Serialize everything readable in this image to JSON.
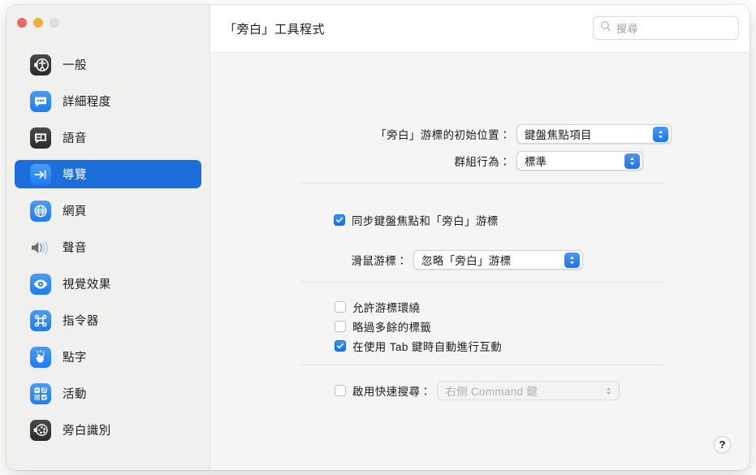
{
  "window": {
    "title": "「旁白」工具程式",
    "traffic_lights": [
      {
        "name": "close",
        "color": "#e8695f"
      },
      {
        "name": "minimize",
        "color": "#edb13e"
      },
      {
        "name": "zoom",
        "color": "#dddddd"
      }
    ]
  },
  "search": {
    "placeholder": "搜尋",
    "value": "",
    "icon": "search-icon"
  },
  "sidebar": {
    "items": [
      {
        "label": "一般",
        "icon": "voiceover-general-icon",
        "selected": false
      },
      {
        "label": "詳細程度",
        "icon": "speech-bubble-dots-icon",
        "selected": false
      },
      {
        "label": "語音",
        "icon": "speech-panel-icon",
        "selected": false
      },
      {
        "label": "導覽",
        "icon": "arrow-to-line-icon",
        "selected": true
      },
      {
        "label": "網頁",
        "icon": "globe-icon",
        "selected": false
      },
      {
        "label": "聲音",
        "icon": "speaker-waves-icon",
        "selected": false
      },
      {
        "label": "視覺效果",
        "icon": "eye-icon",
        "selected": false
      },
      {
        "label": "指令器",
        "icon": "command-key-icon",
        "selected": false
      },
      {
        "label": "點字",
        "icon": "braille-hand-icon",
        "selected": false
      },
      {
        "label": "活動",
        "icon": "activities-grid-icon",
        "selected": false
      },
      {
        "label": "旁白識別",
        "icon": "voiceover-recognition-icon",
        "selected": false
      }
    ]
  },
  "main": {
    "cursor_start_label": "「旁白」游標的初始位置：",
    "cursor_start_value": "鍵盤焦點項目",
    "group_behavior_label": "群組行為：",
    "group_behavior_value": "標準",
    "sync_checkbox_label": "同步鍵盤焦點和「旁白」游標",
    "sync_checkbox_checked": true,
    "mouse_cursor_label": "滑鼠游標：",
    "mouse_cursor_value": "忽略「旁白」游標",
    "allow_wrap_label": "允許游標環繞",
    "allow_wrap_checked": false,
    "skip_redundant_label": "略過多餘的標籤",
    "skip_redundant_checked": false,
    "tab_interact_label": "在使用 Tab 鍵時自動進行互動",
    "tab_interact_checked": true,
    "quicknav_label": "啟用快速搜尋：",
    "quicknav_checked": false,
    "quicknav_value": "右側 Command 鍵",
    "quicknav_disabled": true,
    "help_label": "?"
  },
  "colors": {
    "accent": "#1c6fdb",
    "popup_chevron": "#1a76f2",
    "sidebar_bg": "#f0f0ef",
    "content_bg": "#f5f5f5"
  }
}
